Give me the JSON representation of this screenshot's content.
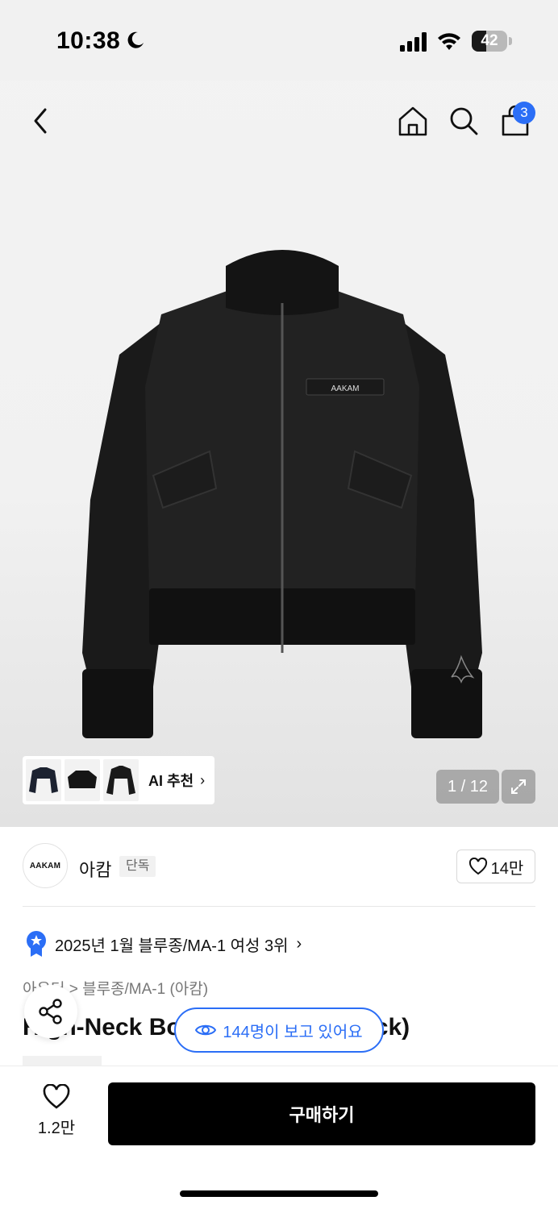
{
  "status_bar": {
    "time": "10:38",
    "battery": "42",
    "battery_level": 0.42
  },
  "cart": {
    "badge_count": "3"
  },
  "gallery": {
    "ai_recommend_label": "AI 추천",
    "page_counter": "1 / 12",
    "jacket_logo_text": "AAKAM"
  },
  "brand": {
    "logo_text": "AAKAM",
    "name": "아캄",
    "exclusive_tag": "단독",
    "like_count": "14만"
  },
  "ranking": {
    "text": "2025년 1월 블루종/MA-1 여성 3위"
  },
  "breadcrumb": {
    "text": "아우터 > 블루종/MA-1 (아캄)"
  },
  "product": {
    "title": "High-Neck Bomber Jacket (Black)"
  },
  "viewers": {
    "text": "144명이 보고 있어요"
  },
  "bottom": {
    "wish_count": "1.2만",
    "buy_label": "구매하기"
  },
  "colors": {
    "accent_blue": "#2b6ef6",
    "buy_button": "#000000"
  }
}
